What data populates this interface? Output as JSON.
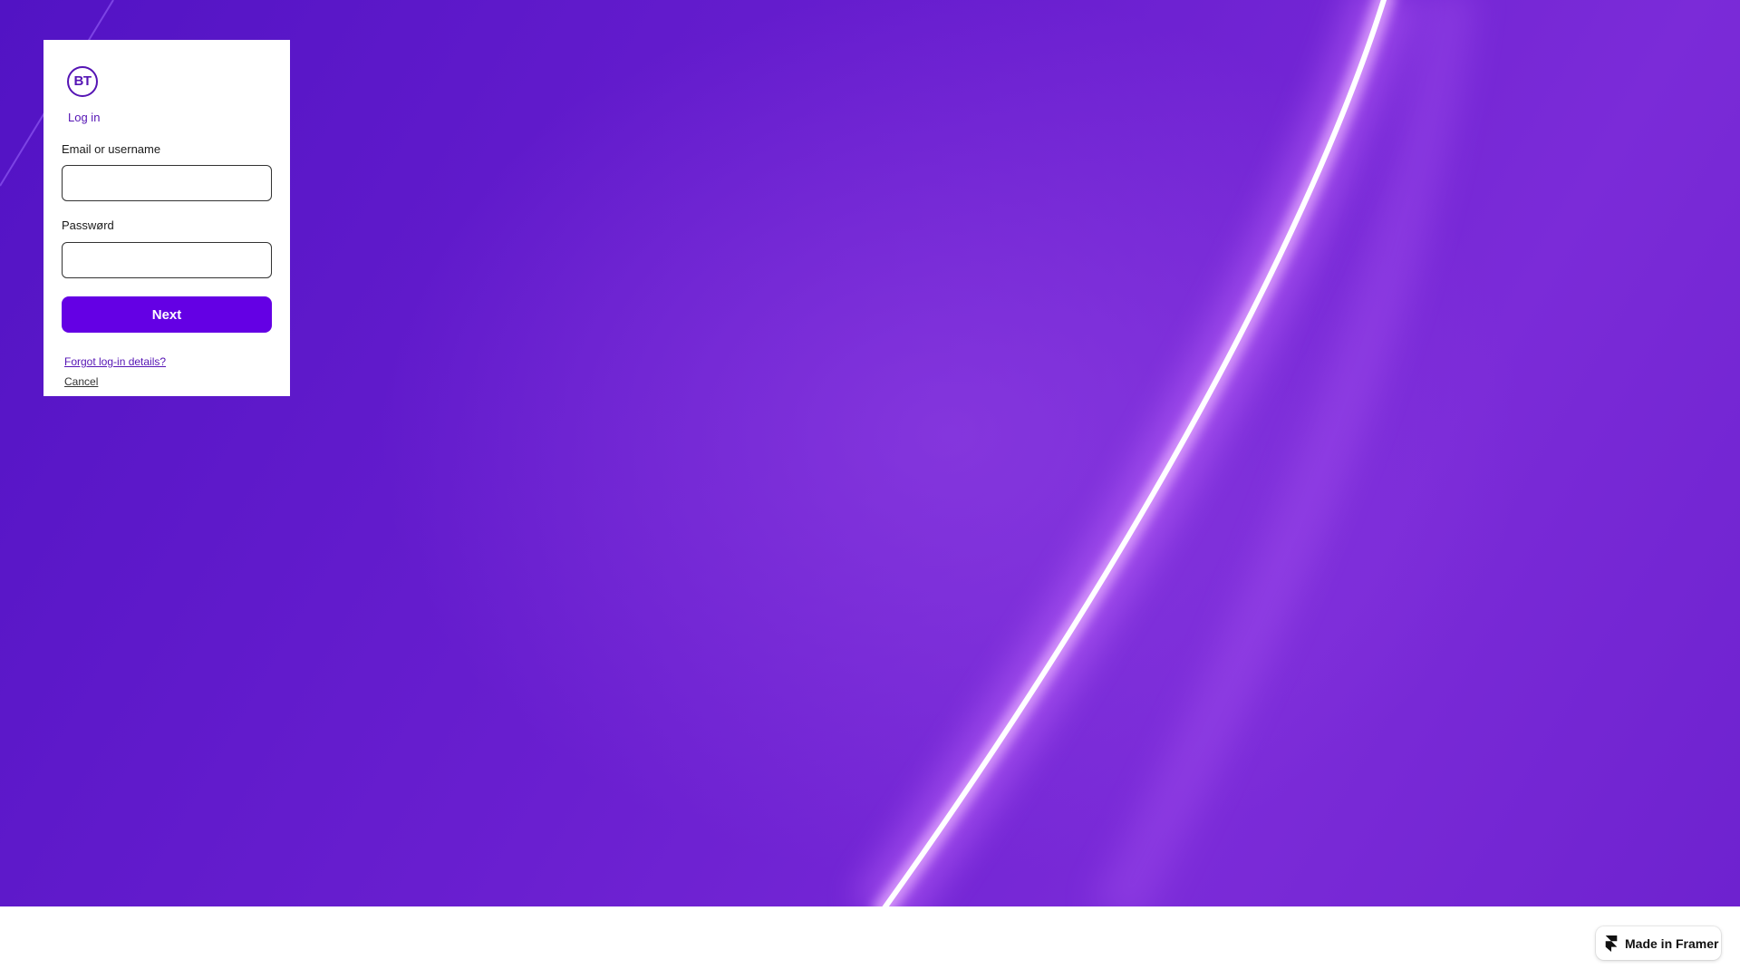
{
  "brand": {
    "logo_text": "BT",
    "accent_color": "#5514b4",
    "button_color": "#6400e4"
  },
  "login": {
    "title": "Log in",
    "email_label": "Email or username",
    "email_value": "",
    "email_placeholder": "",
    "password_label": "Passwørd",
    "password_value": "",
    "password_placeholder": "",
    "next_button": "Next",
    "forgot_link": "Forgot log-in details?",
    "cancel_link": "Cancel"
  },
  "footer_badge": {
    "label": "Made in Framer",
    "icon": "framer-icon"
  }
}
